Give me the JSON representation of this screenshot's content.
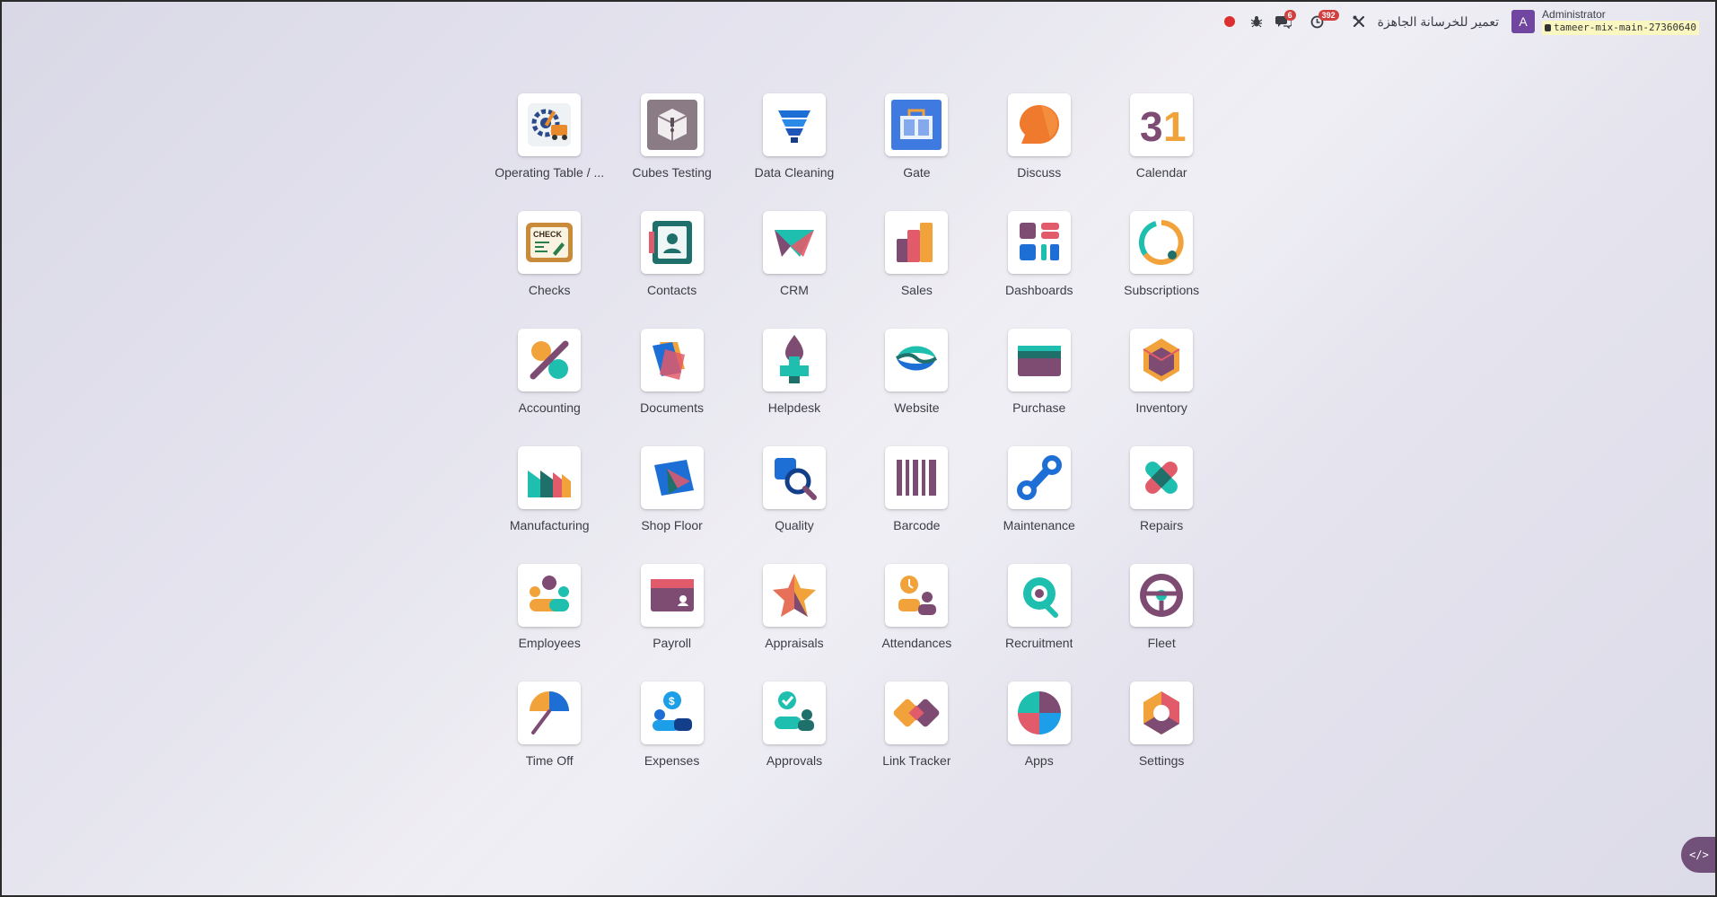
{
  "navbar": {
    "chat_badge": "6",
    "activity_badge": "392",
    "company": "تعمير للخرسانة الجاهزة",
    "avatar_letter": "A",
    "user_name": "Administrator",
    "database": "tameer-mix-main-27360640"
  },
  "apps": [
    {
      "label": "Operating Table / ...",
      "icon": "operating-table-icon"
    },
    {
      "label": "Cubes Testing",
      "icon": "cubes-testing-icon"
    },
    {
      "label": "Data Cleaning",
      "icon": "data-cleaning-icon"
    },
    {
      "label": "Gate",
      "icon": "gate-icon"
    },
    {
      "label": "Discuss",
      "icon": "discuss-icon"
    },
    {
      "label": "Calendar",
      "icon": "calendar-icon"
    },
    {
      "label": "Checks",
      "icon": "checks-icon"
    },
    {
      "label": "Contacts",
      "icon": "contacts-icon"
    },
    {
      "label": "CRM",
      "icon": "crm-icon"
    },
    {
      "label": "Sales",
      "icon": "sales-icon"
    },
    {
      "label": "Dashboards",
      "icon": "dashboards-icon"
    },
    {
      "label": "Subscriptions",
      "icon": "subscriptions-icon"
    },
    {
      "label": "Accounting",
      "icon": "accounting-icon"
    },
    {
      "label": "Documents",
      "icon": "documents-icon"
    },
    {
      "label": "Helpdesk",
      "icon": "helpdesk-icon"
    },
    {
      "label": "Website",
      "icon": "website-icon"
    },
    {
      "label": "Purchase",
      "icon": "purchase-icon"
    },
    {
      "label": "Inventory",
      "icon": "inventory-icon"
    },
    {
      "label": "Manufacturing",
      "icon": "manufacturing-icon"
    },
    {
      "label": "Shop Floor",
      "icon": "shop-floor-icon"
    },
    {
      "label": "Quality",
      "icon": "quality-icon"
    },
    {
      "label": "Barcode",
      "icon": "barcode-icon"
    },
    {
      "label": "Maintenance",
      "icon": "maintenance-icon"
    },
    {
      "label": "Repairs",
      "icon": "repairs-icon"
    },
    {
      "label": "Employees",
      "icon": "employees-icon"
    },
    {
      "label": "Payroll",
      "icon": "payroll-icon"
    },
    {
      "label": "Appraisals",
      "icon": "appraisals-icon"
    },
    {
      "label": "Attendances",
      "icon": "attendances-icon"
    },
    {
      "label": "Recruitment",
      "icon": "recruitment-icon"
    },
    {
      "label": "Fleet",
      "icon": "fleet-icon"
    },
    {
      "label": "Time Off",
      "icon": "time-off-icon"
    },
    {
      "label": "Expenses",
      "icon": "expenses-icon"
    },
    {
      "label": "Approvals",
      "icon": "approvals-icon"
    },
    {
      "label": "Link Tracker",
      "icon": "link-tracker-icon"
    },
    {
      "label": "Apps",
      "icon": "apps-icon"
    },
    {
      "label": "Settings",
      "icon": "settings-icon"
    }
  ],
  "debug_button_glyph": "</>"
}
